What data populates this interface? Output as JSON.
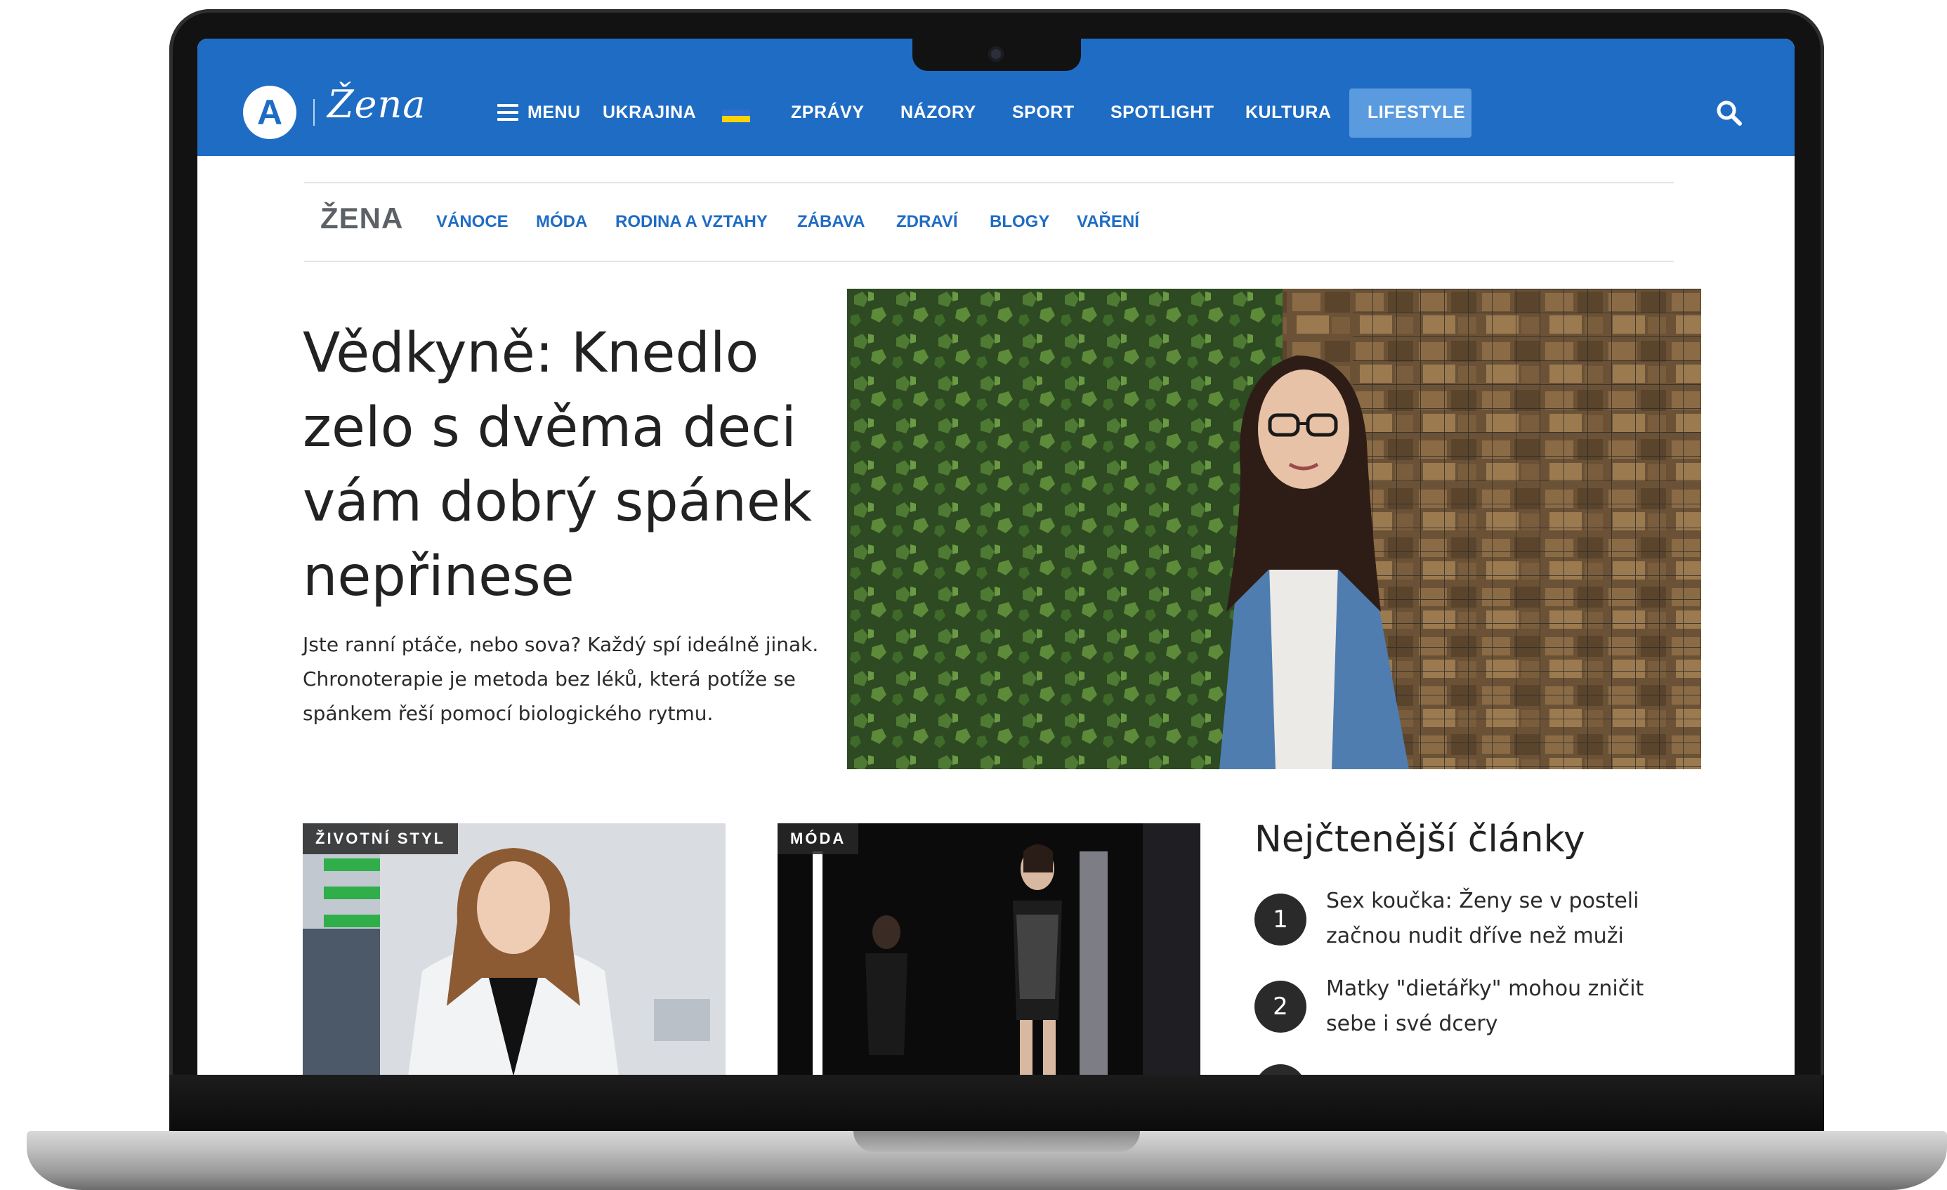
{
  "brand": {
    "logo_letter": "A",
    "section_script": "Žena"
  },
  "topnav": {
    "items": [
      {
        "label": "MENU"
      },
      {
        "label": "UKRAJINA"
      },
      {
        "label": "ZPRÁVY"
      },
      {
        "label": "NÁZORY"
      },
      {
        "label": "SPORT"
      },
      {
        "label": "SPOTLIGHT"
      },
      {
        "label": "KULTURA"
      },
      {
        "label": "LIFESTYLE"
      }
    ],
    "active_item": "LIFESTYLE",
    "colors": {
      "bar": "#1f6cc4",
      "active": "#5a9bdf"
    }
  },
  "subnav": {
    "brand": "ŽENA",
    "items": [
      {
        "label": "VÁNOCE"
      },
      {
        "label": "MÓDA"
      },
      {
        "label": "RODINA A VZTAHY"
      },
      {
        "label": "ZÁBAVA"
      },
      {
        "label": "ZDRAVÍ"
      },
      {
        "label": "BLOGY"
      },
      {
        "label": "VAŘENÍ"
      }
    ]
  },
  "hero": {
    "title": "Vědkyně: Knedlo zelo s dvěma deci vám dobrý spánek nepřinese",
    "lead": "Jste ranní ptáče, nebo sova? Každý spí ideálně jinak. Chronoterapie je metoda bez léků, která potíže se spánkem řeší pomocí biologického rytmu."
  },
  "cards": [
    {
      "tag": "ŽIVOTNÍ STYL"
    },
    {
      "tag": "MÓDA"
    }
  ],
  "most_read": {
    "title": "Nejčtenější články",
    "items": [
      {
        "rank": "1",
        "text": "Sex koučka: Ženy se v posteli začnou nudit dříve než muži"
      },
      {
        "rank": "2",
        "text": "Matky \"dietářky\" mohou zničit sebe i své dcery"
      }
    ]
  }
}
